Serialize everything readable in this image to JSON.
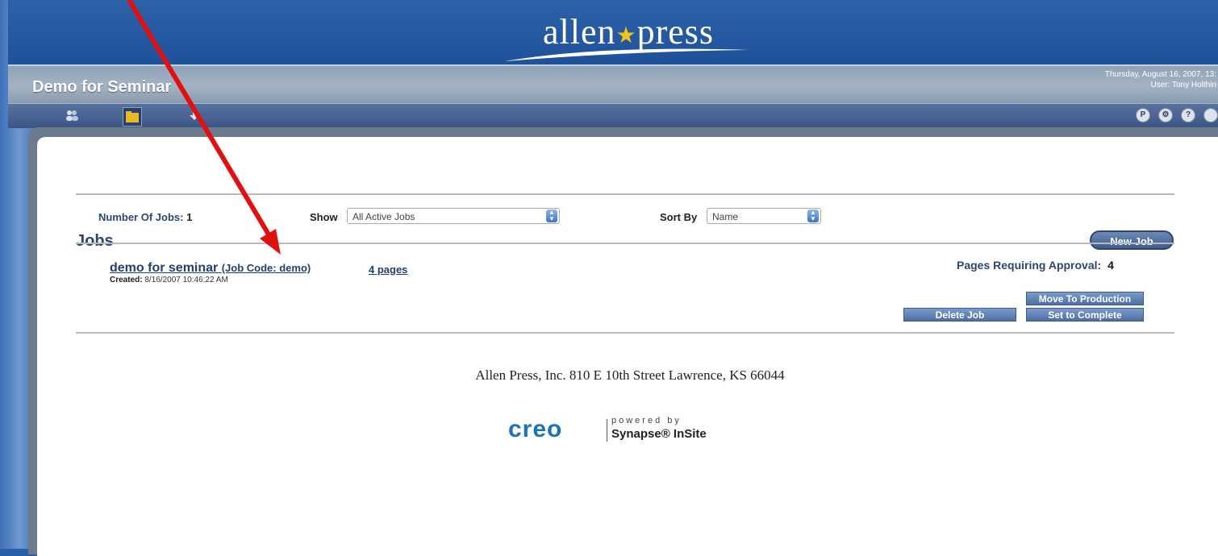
{
  "header": {
    "logo_text": "allen",
    "logo_text_2": "press",
    "app_title": "Demo for Seminar",
    "datetime": "Thursday, August 16, 2007, 13:",
    "user": "User: Tony Holthin"
  },
  "toolbar": {
    "left_icons": [
      "users-icon",
      "folder-icon",
      "download-icon"
    ],
    "right_buttons": [
      {
        "label": "P",
        "icon": "preferences-icon"
      },
      {
        "label": "⚙",
        "icon": "tools-icon"
      },
      {
        "label": "?",
        "icon": "help-icon"
      },
      {
        "label": "",
        "icon": "logout-icon"
      }
    ]
  },
  "jobs": {
    "title": "Jobs",
    "new_job_label": "New Job",
    "count_label": "Number Of Jobs:",
    "count": "1",
    "show_label": "Show",
    "show_value": "All Active Jobs",
    "sort_label": "Sort By",
    "sort_value": "Name",
    "items": [
      {
        "name": "demo for seminar",
        "code": "(Job Code: demo)",
        "pages": "4 pages",
        "created_label": "Created:",
        "created": "8/16/2007 10:46:22 AM",
        "approval_label": "Pages Requiring Approval:",
        "approval_count": "4",
        "move_label": "Move To Production",
        "complete_label": "Set to Complete",
        "delete_label": "Delete Job"
      }
    ]
  },
  "footer": {
    "address": "Allen Press, Inc. 810 E 10th Street Lawrence, KS 66044",
    "creo": "creo",
    "powered": "powered by",
    "synapse": "Synapse® InSite"
  },
  "colors": {
    "banner": "#1f5199",
    "accent": "#2c4670",
    "arrow": "#e01010",
    "star": "#f4c21c"
  }
}
